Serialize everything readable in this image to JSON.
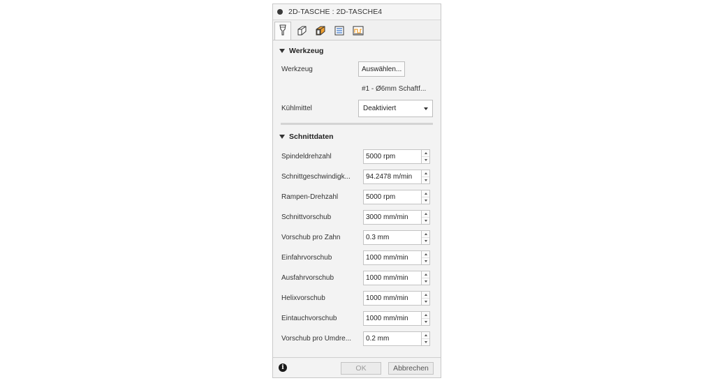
{
  "dialog": {
    "title": "2D-TASCHE : 2D-TASCHE4"
  },
  "tabs": [
    {
      "icon": "tool-icon",
      "active": true
    },
    {
      "icon": "geometry-icon",
      "active": false
    },
    {
      "icon": "heights-icon",
      "active": false
    },
    {
      "icon": "passes-icon",
      "active": false
    },
    {
      "icon": "linking-icon",
      "active": false
    }
  ],
  "werkzeug": {
    "heading": "Werkzeug",
    "tool_label": "Werkzeug",
    "select_button": "Auswählen...",
    "tool_info": "#1 - Ø6mm Schaftf...",
    "coolant_label": "Kühlmittel",
    "coolant_value": "Deaktiviert"
  },
  "schnittdaten": {
    "heading": "Schnittdaten",
    "rows": [
      {
        "label": "Spindeldrehzahl",
        "value": "5000 rpm"
      },
      {
        "label": "Schnittgeschwindigk...",
        "value": "94.2478 m/min"
      },
      {
        "label": "Rampen-Drehzahl",
        "value": "5000 rpm"
      },
      {
        "label": "Schnittvorschub",
        "value": "3000 mm/min"
      },
      {
        "label": "Vorschub pro Zahn",
        "value": "0.3 mm"
      },
      {
        "label": "Einfahrvorschub",
        "value": "1000 mm/min"
      },
      {
        "label": "Ausfahrvorschub",
        "value": "1000 mm/min"
      },
      {
        "label": "Helixvorschub",
        "value": "1000 mm/min"
      },
      {
        "label": "Eintauchvorschub",
        "value": "1000 mm/min"
      },
      {
        "label": "Vorschub pro Umdre...",
        "value": "0.2 mm"
      }
    ]
  },
  "footer": {
    "info_glyph": "i",
    "ok": "OK",
    "cancel": "Abbrechen"
  },
  "colors": {
    "panel_bg": "#f3f3f3",
    "accent_orange": "#f0a030",
    "disabled_text": "#9a9a9a"
  }
}
